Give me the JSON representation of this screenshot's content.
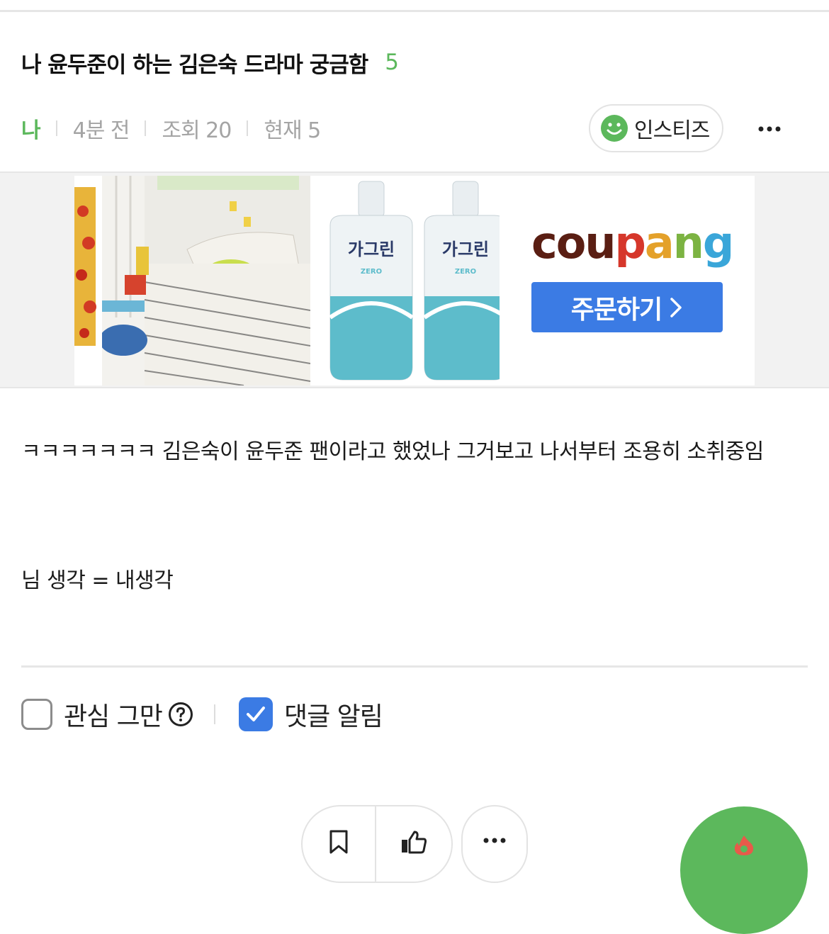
{
  "post": {
    "title": "나 윤두준이 하는 김은숙 드라마 궁금함",
    "comment_count": "5",
    "author": "나",
    "time": "4분 전",
    "views": "조회 20",
    "current": "현재 5",
    "board_button": "인스티즈"
  },
  "ad": {
    "brand": [
      "c",
      "o",
      "u",
      "p",
      "a",
      "n",
      "g"
    ],
    "brand_colors": [
      "#5a1e13",
      "#5a1e13",
      "#5a1e13",
      "#d6372b",
      "#e4a12a",
      "#7cb342",
      "#3aa6d9"
    ],
    "order_label": "주문하기"
  },
  "content": {
    "line1": "ㅋㅋㅋㅋㅋㅋㅋ 김은숙이 윤두준 팬이라고 했었나 그거보고 나서부터 조용히 소취중임",
    "line2": "님 생각 = 내생각"
  },
  "options": {
    "unfollow_label": "관심 그만",
    "notify_label": "댓글 알림",
    "unfollow_checked": false,
    "notify_checked": true
  },
  "colors": {
    "accent_green": "#5cb85c",
    "accent_blue": "#3b7be4",
    "meta_gray": "#a4a4a4"
  }
}
